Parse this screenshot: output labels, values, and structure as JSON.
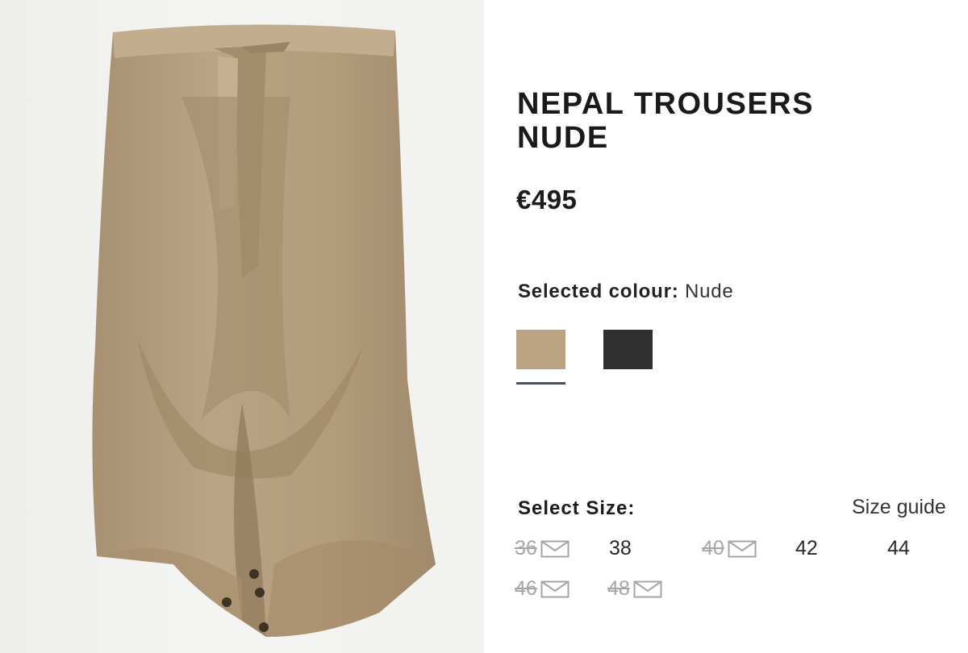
{
  "product": {
    "title_line1": "NEPAL TROUSERS",
    "title_line2": "NUDE",
    "price": "€495",
    "image_icon": "trousers-product-photo"
  },
  "colour": {
    "label": "Selected colour:",
    "value": "Nude",
    "swatches": [
      {
        "name": "Nude",
        "color": "#bca382",
        "selected": true
      },
      {
        "name": "Black",
        "color": "#2f2f2f",
        "selected": false
      }
    ]
  },
  "size": {
    "label": "Select Size:",
    "guide_label": "Size guide",
    "notify_icon": "mail-icon",
    "options": [
      {
        "value": "36",
        "available": false
      },
      {
        "value": "38",
        "available": true
      },
      {
        "value": "40",
        "available": false
      },
      {
        "value": "42",
        "available": true
      },
      {
        "value": "44",
        "available": true
      },
      {
        "value": "46",
        "available": false
      },
      {
        "value": "48",
        "available": false
      }
    ]
  },
  "colors": {
    "fabric": "#b59f7f",
    "fabric_shadow": "#9c8566",
    "text": "#1b1b1b",
    "unavailable": "#a6a6a6"
  }
}
